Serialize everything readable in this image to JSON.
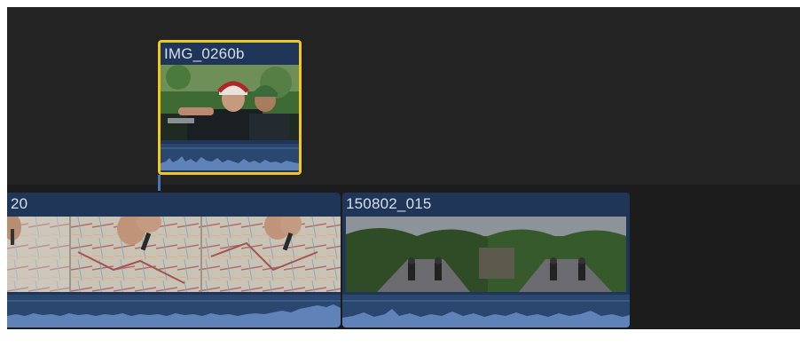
{
  "timeline": {
    "connected_clip": {
      "name": "IMG_0260b",
      "selected": true
    },
    "primary_storyline": [
      {
        "name": "20"
      },
      {
        "name": "150802_015"
      }
    ]
  },
  "colors": {
    "background": "#232323",
    "clip_fill": "#1f3658",
    "waveform": "#5f82b8",
    "selection": "#f2c81e"
  },
  "icons": [
    "clip-connector"
  ]
}
